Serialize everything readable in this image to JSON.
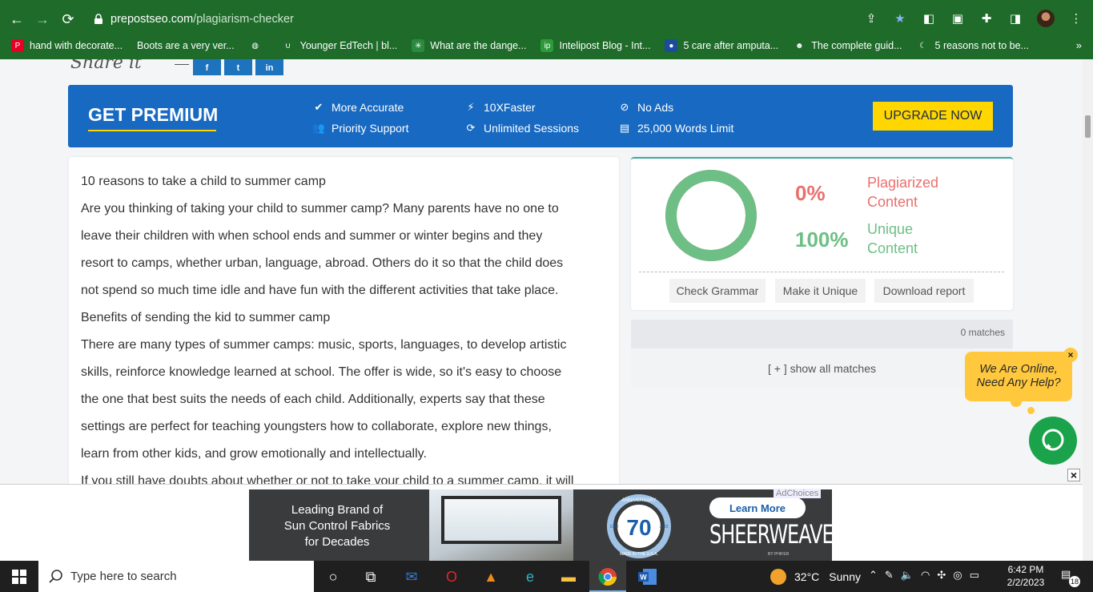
{
  "browser": {
    "url_host": "prepostseo.com",
    "url_path": "/plagiarism-checker",
    "bookmarks": [
      {
        "label": "hand with decorate...",
        "fav": "pinterest",
        "color": "#e60023"
      },
      {
        "label": "Boots are a very ver...",
        "fav": "none",
        "color": "#1e6b2a"
      },
      {
        "label": "",
        "fav": "globe",
        "color": "#1e6b2a"
      },
      {
        "label": "Younger EdTech | bl...",
        "fav": "ye",
        "color": "#1e6b2a"
      },
      {
        "label": "What are the dange...",
        "fav": "tree",
        "color": "#2b8a3e"
      },
      {
        "label": "Intelipost Blog - Int...",
        "fav": "ip",
        "color": "#2d9b3a"
      },
      {
        "label": "5 care after amputa...",
        "fav": "circle",
        "color": "#1c4c9c"
      },
      {
        "label": "The complete guid...",
        "fav": "ninja",
        "color": "#1e6b2a"
      },
      {
        "label": "5 reasons not to be...",
        "fav": "moon",
        "color": "#1e6b2a"
      }
    ],
    "more_label": "»"
  },
  "share": {
    "label": "Share it",
    "buttons": [
      "f",
      "t",
      "in"
    ]
  },
  "premium": {
    "title": "GET PREMIUM",
    "features": [
      {
        "icon": "check-icon",
        "glyph": "✔",
        "label": "More Accurate"
      },
      {
        "icon": "users-icon",
        "glyph": "👥",
        "label": "Priority Support"
      },
      {
        "icon": "bolt-icon",
        "glyph": "⚡",
        "label": "10XFaster"
      },
      {
        "icon": "sync-icon",
        "glyph": "⟳",
        "label": "Unlimited Sessions"
      },
      {
        "icon": "ban-icon",
        "glyph": "⊘",
        "label": "No Ads"
      },
      {
        "icon": "document-icon",
        "glyph": "▤",
        "label": "25,000 Words Limit"
      }
    ],
    "upgrade_label": "UPGRADE NOW",
    "accent": "#ffd600",
    "bg": "#1769c2"
  },
  "article": {
    "lines": [
      "10 reasons to take a child to summer camp",
      "Are you thinking of taking your child to summer camp? Many parents have no one to",
      "leave their children with when school ends and summer or winter begins and they",
      "resort to camps, whether urban, language, abroad. Others do it so that the child does",
      "not spend so much time idle and have fun with the different activities that take place.",
      "Benefits of sending the kid to summer camp",
      "There are many types of summer camps: music, sports, languages, to develop artistic",
      "skills, reinforce knowledge learned at school. The offer is wide, so it's easy to choose",
      "the one that best suits the needs of each child. Additionally, experts say that these",
      "settings are perfect for teaching youngsters how to collaborate, explore new things,",
      "learn from other kids, and grow emotionally and intellectually.",
      "If you still have doubts about whether or not to take your child to a summer camp, it will"
    ]
  },
  "result": {
    "plagiarized_pct": "0%",
    "plagiarized_label_1": "Plagiarized",
    "plagiarized_label_2": "Content",
    "unique_pct": "100%",
    "unique_label_1": "Unique",
    "unique_label_2": "Content",
    "unique_fraction": 1.0,
    "actions": [
      "Check Grammar",
      "Make it Unique",
      "Download report"
    ],
    "matches_count": "0 matches",
    "show_all": "[ + ] show all matches",
    "red": "#e9706d",
    "green": "#6dbf85"
  },
  "chat": {
    "line1": "We Are Online,",
    "line2": "Need Any Help?",
    "close": "×"
  },
  "ad": {
    "copy_1": "Leading Brand of",
    "copy_2": "Sun Control Fabrics",
    "copy_3": "for Decades",
    "badge_number": "70",
    "badge_top": "ANNIVERSARY",
    "badge_left": "1952",
    "badge_right": "2022",
    "badge_bottom": "MADE IN THE U.S.A.",
    "learn_more": "Learn More",
    "brand": "SHEERWEAVE",
    "brand_sub": "BY PHIFER",
    "adchoices": "AdChoices",
    "close": "×"
  },
  "taskbar": {
    "search_placeholder": "Type here to search",
    "temperature": "32°C",
    "condition": "Sunny",
    "time": "6:42 PM",
    "date": "2/2/2023",
    "notifications": "18"
  }
}
